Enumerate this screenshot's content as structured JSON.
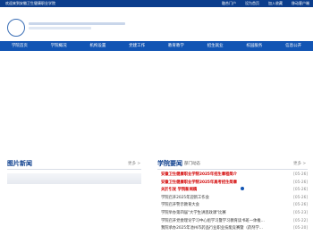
{
  "topbar": {
    "welcome": "欢迎来到安徽卫生健康职业学院",
    "links": [
      "融合门户",
      "设为首页",
      "加入收藏",
      "移动客户端"
    ]
  },
  "nav": {
    "items": [
      "学院首页",
      "学院概况",
      "机构设置",
      "党建工作",
      "教育教学",
      "招生就业",
      "校园服务",
      "信息公开"
    ]
  },
  "photo_news": {
    "title": "图片新闻",
    "more": "更多 >"
  },
  "school_news": {
    "title": "学院要闻",
    "sub_tab": "部门动态",
    "more": "更多 >",
    "items": [
      {
        "title": "安徽卫生健康职业学院2025年招生章程简介",
        "date": "[05-26]",
        "highlight": true
      },
      {
        "title": "安徽卫生健康职业学院2025年高考招生简章",
        "date": "[05-26]",
        "highlight": true
      },
      {
        "title": "关於引发 学院新闻稿",
        "date": "[05-26]",
        "highlight": true
      },
      {
        "title": "学院召开2025年迎新工作会",
        "date": "[05-26]",
        "highlight": false
      },
      {
        "title": "学院召开警示教育大会",
        "date": "[05-26]",
        "highlight": false
      },
      {
        "title": "学院举办第四届\"大学生讲思政课\"比赛",
        "date": "[05-23]",
        "highlight": false
      },
      {
        "title": "学院召开党委理论学习中心组学习暨学习教育读书班一体推...",
        "date": "[05-22]",
        "highlight": false
      },
      {
        "title": "我院承办2025年池州市药品行业职业技能竞赛暨（药剂学...",
        "date": "[05-20]",
        "highlight": false
      }
    ]
  }
}
